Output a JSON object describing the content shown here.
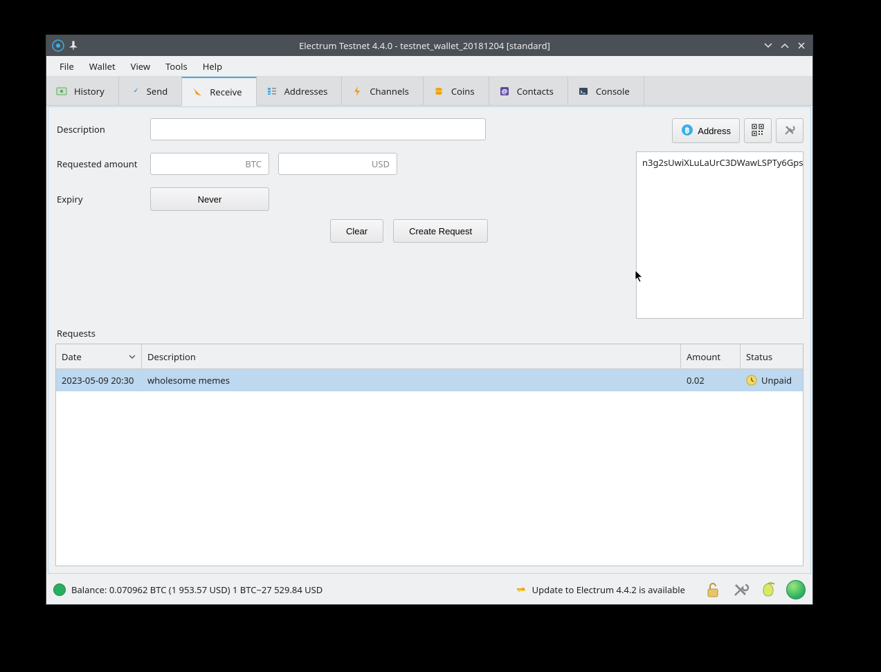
{
  "window": {
    "title": "Electrum Testnet 4.4.0 - testnet_wallet_20181204 [standard]"
  },
  "menu": {
    "file": "File",
    "wallet": "Wallet",
    "view": "View",
    "tools": "Tools",
    "help": "Help"
  },
  "tabs": {
    "history": "History",
    "send": "Send",
    "receive": "Receive",
    "addresses": "Addresses",
    "channels": "Channels",
    "coins": "Coins",
    "contacts": "Contacts",
    "console": "Console"
  },
  "form": {
    "description_label": "Description",
    "description_value": "",
    "requested_amount_label": "Requested amount",
    "btc_unit": "BTC",
    "usd_unit": "USD",
    "expiry_label": "Expiry",
    "expiry_value": "Never",
    "clear": "Clear",
    "create_request": "Create Request"
  },
  "toolbar": {
    "address_label": "Address"
  },
  "address_panel": {
    "address": "n3g2sUwiXLuLaUrC3DWawLSPTy6Gps"
  },
  "requests": {
    "label": "Requests",
    "columns": {
      "date": "Date",
      "description": "Description",
      "amount": "Amount",
      "status": "Status"
    },
    "rows": [
      {
        "date": "2023-05-09 20:30",
        "description": "wholesome memes",
        "amount": "0.02",
        "status": "Unpaid"
      }
    ]
  },
  "statusbar": {
    "balance": "Balance: 0.070962 BTC (1 953.57 USD)  1 BTC~27 529.84 USD",
    "update": "Update to Electrum 4.4.2 is available"
  }
}
